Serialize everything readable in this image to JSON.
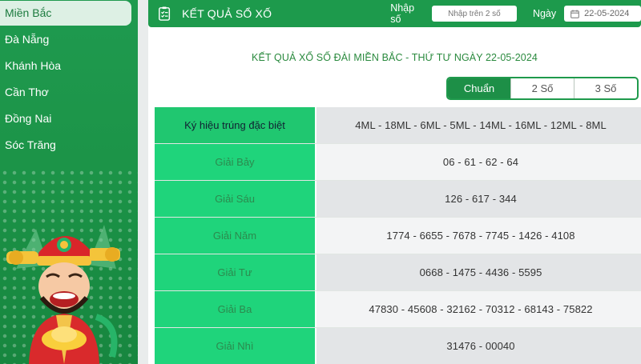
{
  "sidebar": {
    "items": [
      {
        "label": "Miền Bắc",
        "active": true
      },
      {
        "label": "Đà Nẵng"
      },
      {
        "label": "Khánh Hòa"
      },
      {
        "label": "Cần Thơ"
      },
      {
        "label": "Đồng Nai"
      },
      {
        "label": "Sóc Trăng"
      }
    ]
  },
  "header": {
    "title": "KẾT QUẢ SỔ XỐ",
    "number_label": "Nhập số",
    "number_placeholder": "Nhập trên 2 số",
    "date_label": "Ngày",
    "date_value": "22-05-2024",
    "icon": "document-list-icon"
  },
  "result_title": "KẾT QUẢ XỔ SỐ ĐÀI MIỀN BẮC - THỨ TƯ NGÀY 22-05-2024",
  "tabs": [
    {
      "label": "Chuẩn",
      "active": true
    },
    {
      "label": "2 Số"
    },
    {
      "label": "3 Số"
    }
  ],
  "results": [
    {
      "name": "Ký hiệu trúng đặc biệt",
      "value": "4ML - 18ML - 6ML - 5ML - 14ML - 16ML - 12ML - 8ML"
    },
    {
      "name": "Giải Bảy",
      "value": "06 - 61 - 62 - 64"
    },
    {
      "name": "Giải Sáu",
      "value": "126 - 617 - 344"
    },
    {
      "name": "Giải Năm",
      "value": "1774 - 6655 - 7678 - 7745 - 1426 - 4108"
    },
    {
      "name": "Giải Tư",
      "value": "0668 - 1475 - 4436 - 5595"
    },
    {
      "name": "Giải Ba",
      "value": "47830 - 45608 - 32162 - 70312 - 68143 - 75822"
    },
    {
      "name": "Giải Nhì",
      "value": "31476 - 00040"
    }
  ],
  "colors": {
    "brand_green": "#1d9a4c",
    "row_label_green": "#1fd47b",
    "title_green": "#2a8a3e"
  }
}
